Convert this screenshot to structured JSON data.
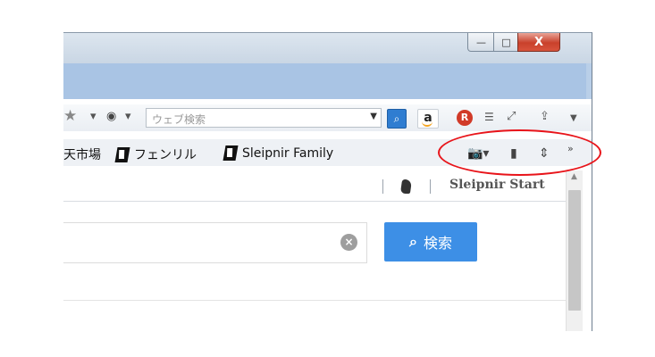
{
  "window": {
    "buttons": {
      "minimize": "—",
      "maximize": "□",
      "close": "X"
    }
  },
  "toolbar": {
    "search_placeholder": "ウェブ検索",
    "icons": [
      "star-icon",
      "chevron-down-icon",
      "globe-icon",
      "search-icon",
      "amazon-icon",
      "r-icon",
      "menu-icon",
      "expand-icon",
      "share-icon"
    ]
  },
  "bookmarks": {
    "items": [
      {
        "label": "天市場"
      },
      {
        "label": "フェンリル"
      },
      {
        "label": "Sleipnir Family"
      }
    ],
    "right_icons": [
      "camera-icon",
      "document-icon",
      "document-export-icon",
      "more-icon"
    ],
    "overflow": "»"
  },
  "tab": {
    "title": "Sleipnir Start"
  },
  "page": {
    "search_button_label": "検索",
    "clear_symbol": "×"
  },
  "colors": {
    "accent_blue": "#3d8fe6",
    "frame_blue": "#a9c4e4",
    "highlight_red": "#e8141a",
    "close_red": "#c9412b"
  }
}
